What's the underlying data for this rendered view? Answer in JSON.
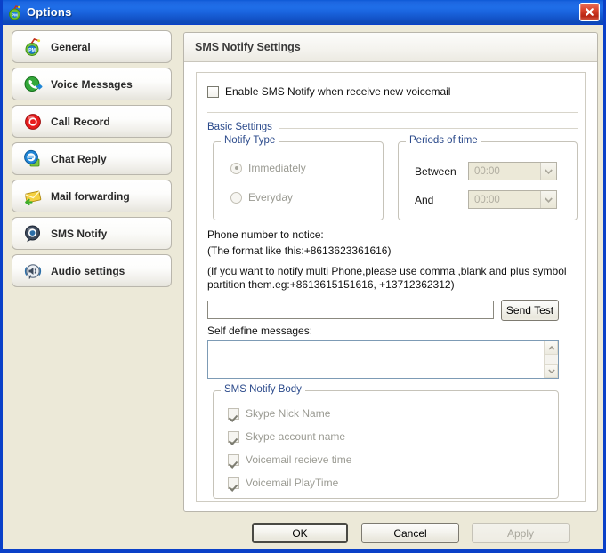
{
  "window": {
    "title": "Options",
    "icon": "options-app-icon",
    "close_icon": "close-icon",
    "frame_color": "#0a40c8",
    "titlebar_color": "#1f6ee8",
    "body_color": "#ece9d8"
  },
  "sidebar": {
    "items": [
      {
        "label": "General",
        "icon": "pm-general-icon",
        "selected": false
      },
      {
        "label": "Voice Messages",
        "icon": "voice-messages-icon",
        "selected": false
      },
      {
        "label": "Call Record",
        "icon": "call-record-icon",
        "selected": false
      },
      {
        "label": "Chat Reply",
        "icon": "chat-reply-icon",
        "selected": false
      },
      {
        "label": "Mail forwarding",
        "icon": "mail-forwarding-icon",
        "selected": false
      },
      {
        "label": "SMS Notify",
        "icon": "sms-notify-icon",
        "selected": true
      },
      {
        "label": "Audio settings",
        "icon": "audio-settings-icon",
        "selected": false
      }
    ]
  },
  "panel": {
    "header": "SMS Notify Settings",
    "enable_checkbox": {
      "label": "Enable SMS Notify when receive new voicemail",
      "checked": false
    },
    "basic_settings_label": "Basic Settings",
    "notify_type": {
      "legend": "Notify Type",
      "options": [
        {
          "label": "Immediately",
          "selected": true
        },
        {
          "label": "Everyday",
          "selected": false
        }
      ]
    },
    "periods_of_time": {
      "legend": "Periods of time",
      "between_label": "Between",
      "between_value": "00:00",
      "and_label": "And",
      "and_value": "00:00",
      "arrow_icon": "chevron-down-icon"
    },
    "phone": {
      "title": "Phone number to notice:",
      "format_hint": "(The format like this:+8613623361616)",
      "multi_hint_line1": "(If you want to notify multi Phone,please use comma ,blank and plus symbol",
      "multi_hint_line2": "partition them.eg:+8613615151616, +13712362312)",
      "input_value": "",
      "input_placeholder": "",
      "send_test_label": "Send Test"
    },
    "self_define": {
      "label": "Self define messages:",
      "value": "",
      "placeholder": "",
      "scroll_up_icon": "scroll-up-icon",
      "scroll_down_icon": "scroll-down-icon"
    },
    "sms_notify_body": {
      "legend": "SMS Notify Body",
      "items": [
        {
          "label": "Skype Nick Name",
          "checked": true,
          "disabled": true
        },
        {
          "label": "Skype account name",
          "checked": true,
          "disabled": true
        },
        {
          "label": "Voicemail recieve time",
          "checked": true,
          "disabled": true
        },
        {
          "label": "Voicemail PlayTime",
          "checked": true,
          "disabled": true
        }
      ]
    }
  },
  "footer": {
    "ok_label": "OK",
    "cancel_label": "Cancel",
    "apply_label": "Apply",
    "apply_disabled": true
  }
}
